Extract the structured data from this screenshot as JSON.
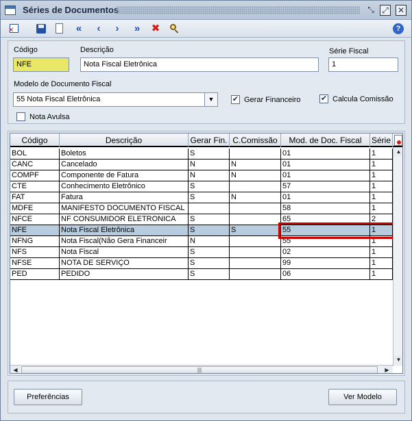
{
  "window": {
    "title": "Séries de Documentos"
  },
  "toolbar": {
    "icons": [
      "exit-icon",
      "save-icon",
      "new-document-icon",
      "first-record-icon",
      "previous-record-icon",
      "next-record-icon",
      "last-record-icon",
      "delete-icon",
      "search-icon",
      "help-icon"
    ],
    "first": "«",
    "previous": "‹",
    "next": "›",
    "last": "»",
    "delete": "✖",
    "help": "?"
  },
  "form": {
    "codigo_label": "Código",
    "codigo_value": "NFE",
    "descricao_label": "Descrição",
    "descricao_value": "Nota Fiscal Eletrônica",
    "serie_fiscal_label": "Série Fiscal",
    "serie_fiscal_value": "1",
    "modelo_label": "Modelo de Documento Fiscal",
    "modelo_value": "55  Nota Fiscal Eletrônica",
    "gerar_financeiro_label": "Gerar Financeiro",
    "gerar_financeiro_checked": true,
    "calcula_comissao_label": "Calcula Comissão",
    "calcula_comissao_checked": true,
    "nota_avulsa_label": "Nota Avulsa",
    "nota_avulsa_checked": false,
    "check_mark": "✔"
  },
  "grid": {
    "columns": [
      "Código",
      "Descrição",
      "Gerar Fin.",
      "C.Comissão",
      "Mod. de Doc. Fiscal",
      "Série"
    ],
    "rows": [
      [
        "BOL",
        "Boletos",
        "S",
        "",
        "01",
        "1"
      ],
      [
        "CANC",
        "Cancelado",
        "N",
        "N",
        "01",
        "1"
      ],
      [
        "COMPF",
        "Componente de Fatura",
        "N",
        "N",
        "01",
        "1"
      ],
      [
        "CTE",
        "Conhecimento Eletrônico",
        "S",
        "",
        "57",
        "1"
      ],
      [
        "FAT",
        "Fatura",
        "S",
        "N",
        "01",
        "1"
      ],
      [
        "MDFE",
        "MANIFESTO DOCUMENTO FISCAL",
        "",
        "",
        "58",
        "1"
      ],
      [
        "NFCE",
        "NF CONSUMIDOR ELETRONICA",
        "S",
        "",
        "65",
        "2"
      ],
      [
        "NFE",
        "Nota Fiscal Eletrônica",
        "S",
        "S",
        "55",
        "1"
      ],
      [
        "NFNG",
        "Nota Fiscal(Não Gera Financeir",
        "N",
        "",
        "55",
        "1"
      ],
      [
        "NFS",
        "Nota Fiscal",
        "S",
        "",
        "02",
        "1"
      ],
      [
        "NFSE",
        "NOTA DE SERVIÇO",
        "S",
        "",
        "99",
        "1"
      ],
      [
        "PED",
        "PEDIDO",
        "S",
        "",
        "06",
        "1"
      ]
    ],
    "selected_row": 7
  },
  "buttons": {
    "preferencias": "Preferências",
    "ver_modelo": "Ver Modelo"
  }
}
